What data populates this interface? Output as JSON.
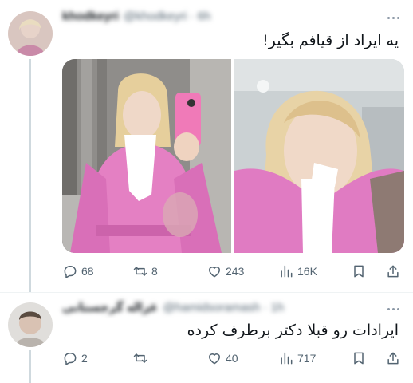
{
  "tweets": [
    {
      "author_name": "khodkeyri",
      "author_handle": "@khodkeyri · 6h",
      "text": "یه ایراد از قیافم بگیر!",
      "images": [
        "photo-mirror-selfie",
        "photo-closeup-selfie"
      ],
      "stats": {
        "replies": "68",
        "retweets": "8",
        "likes": "243",
        "views": "16K"
      }
    },
    {
      "author_name": "غزاله گرجستانی",
      "author_handle": "@hamidsoramash · 1h",
      "text": "ایرادات رو قبلا دکتر برطرف کرده",
      "stats": {
        "replies": "2",
        "retweets": "",
        "likes": "40",
        "views": "717"
      }
    }
  ],
  "icons": {
    "reply": "reply-icon",
    "retweet": "retweet-icon",
    "like": "heart-icon",
    "views": "views-chart-icon",
    "bookmark": "bookmark-icon",
    "share": "share-icon",
    "more": "more-dots-icon"
  },
  "colors": {
    "text": "#0f1419",
    "muted": "#536471",
    "divider": "#eff3f4",
    "robe_pink": "#e07bc2"
  }
}
